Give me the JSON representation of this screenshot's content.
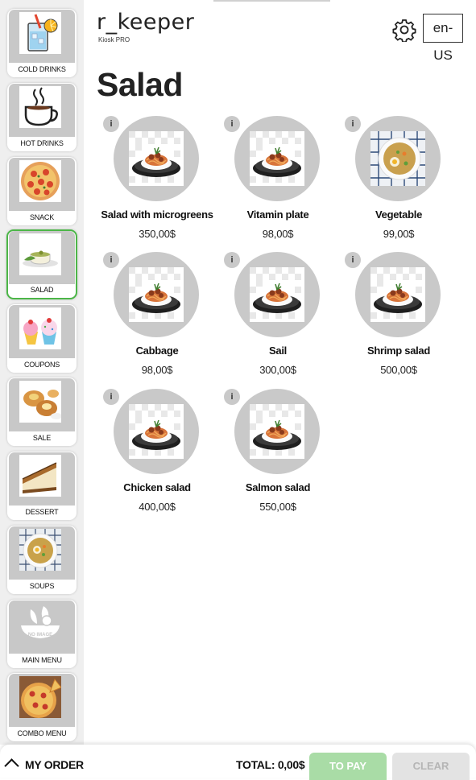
{
  "header": {
    "logo": "r_keeper",
    "logo_sub": "Kiosk PRO",
    "language": "en-US",
    "settings_icon": "gear-icon"
  },
  "page_title": "Salad",
  "categories": [
    {
      "label": "COLD DRINKS",
      "icon": "cold-drink-icon",
      "active": false
    },
    {
      "label": "HOT DRINKS",
      "icon": "coffee-cup-icon",
      "active": false
    },
    {
      "label": "SNACK",
      "icon": "pizza-icon",
      "active": false
    },
    {
      "label": "SALAD",
      "icon": "salad-bowl-icon",
      "active": true
    },
    {
      "label": "COUPONS",
      "icon": "cupcake-icon",
      "active": false
    },
    {
      "label": "SALE",
      "icon": "pastry-icon",
      "active": false
    },
    {
      "label": "DESSERT",
      "icon": "cake-slice-icon",
      "active": false
    },
    {
      "label": "SOUPS",
      "icon": "soup-icon",
      "active": false
    },
    {
      "label": "MAIN MENU",
      "icon": "no-image-icon",
      "badge": "NO IMAGE",
      "active": false
    },
    {
      "label": "COMBO MENU",
      "icon": "pizza-icon",
      "active": false
    }
  ],
  "products": [
    {
      "name": "Salad with microgreens",
      "price": "350,00$",
      "info": "i",
      "image": "pasta-plate"
    },
    {
      "name": "Vitamin plate",
      "price": "98,00$",
      "info": "i",
      "image": "pasta-plate"
    },
    {
      "name": "Vegetable",
      "price": "99,00$",
      "info": "i",
      "image": "soup-bowl"
    },
    {
      "name": "Cabbage",
      "price": "98,00$",
      "info": "i",
      "image": "pasta-plate"
    },
    {
      "name": "Sail",
      "price": "300,00$",
      "info": "i",
      "image": "pasta-plate"
    },
    {
      "name": "Shrimp salad",
      "price": "500,00$",
      "info": "i",
      "image": "pasta-plate"
    },
    {
      "name": "Chicken salad",
      "price": "400,00$",
      "info": "i",
      "image": "pasta-plate"
    },
    {
      "name": "Salmon salad",
      "price": "550,00$",
      "info": "i",
      "image": "pasta-plate"
    }
  ],
  "footer": {
    "my_order": "MY ORDER",
    "total": "TOTAL: 0,00$",
    "to_pay": "TO PAY",
    "clear": "CLEAR"
  },
  "colors": {
    "accent_green": "#4cb648",
    "to_pay_bg": "#a9dca6",
    "clear_bg": "#e3e3e3",
    "circle_grey": "#c9c9c9"
  }
}
